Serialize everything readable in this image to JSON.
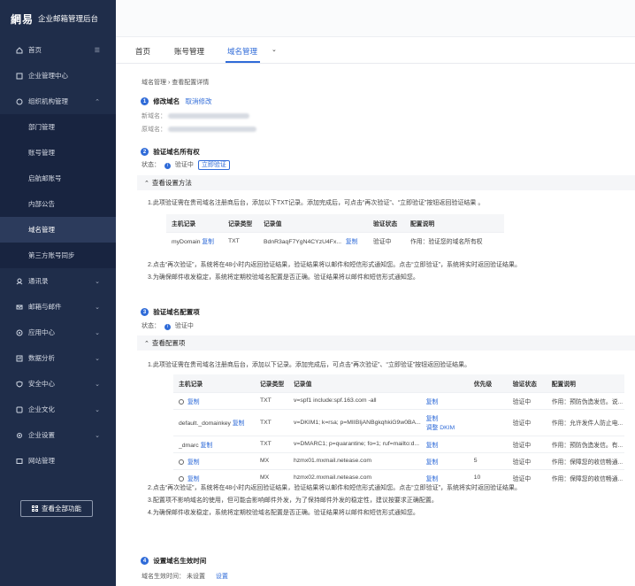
{
  "app": {
    "logo_mark": "網易",
    "title": "企业邮箱管理后台"
  },
  "sidebar": {
    "items": [
      {
        "label": "首页",
        "icon": "home-icon",
        "chevron": ""
      },
      {
        "label": "企业管理中心",
        "icon": "building-icon",
        "chevron": ""
      },
      {
        "label": "组织机构管理",
        "icon": "org-icon",
        "chevron": "up"
      },
      {
        "label": "部门管理",
        "sub": true
      },
      {
        "label": "账号管理",
        "sub": true
      },
      {
        "label": "启航邮账号",
        "sub": true
      },
      {
        "label": "内部公告",
        "sub": true
      },
      {
        "label": "域名管理",
        "sub": true,
        "active": true
      },
      {
        "label": "第三方账号同步",
        "sub": true
      },
      {
        "label": "通讯录",
        "icon": "contacts-icon",
        "chevron": "down"
      },
      {
        "label": "邮箱与邮件",
        "icon": "mail-icon",
        "chevron": "down"
      },
      {
        "label": "应用中心",
        "icon": "app-icon",
        "chevron": "down"
      },
      {
        "label": "数据分析",
        "icon": "chart-icon",
        "chevron": "down"
      },
      {
        "label": "安全中心",
        "icon": "shield-icon",
        "chevron": "down"
      },
      {
        "label": "企业文化",
        "icon": "culture-icon",
        "chevron": "down"
      },
      {
        "label": "企业设置",
        "icon": "gear-icon",
        "chevron": "down"
      },
      {
        "label": "网站管理",
        "icon": "web-icon",
        "chevron": ""
      }
    ],
    "all_functions_label": "查看全部功能"
  },
  "tabs": {
    "home": "首页",
    "account": "账号管理",
    "domain": "域名管理"
  },
  "breadcrumb": {
    "parent": "域名管理",
    "sep": "›",
    "current": "查看配置详情"
  },
  "step1": {
    "num": "1",
    "title": "修改域名",
    "cancel": "取消修改",
    "new_domain_label": "新域名：",
    "old_domain_label": "原域名："
  },
  "step2": {
    "num": "2",
    "title": "验证域名所有权",
    "status_label": "状态：",
    "status_value": "验证中",
    "verify_now": "立即验证",
    "panel_title": "查看设置方法",
    "instr1": "1.此项验证需在贵司域名注册商后台，添加以下TXT记录。添加完成后，可点击“再次验证”、“立即验证”按钮返回验证结果 。",
    "table": {
      "headers": [
        "主机记录",
        "记录类型",
        "记录值",
        "",
        "验证状态",
        "配置说明"
      ],
      "row": {
        "host": "myDomain",
        "copy": "复制",
        "type": "TXT",
        "value": "BdnR3aqF7YgN4CYzU4Fx...",
        "copy2": "复制",
        "status": "验证中",
        "desc": "作用：验证您的域名所有权"
      }
    },
    "instr2": "2.点击“再次验证”，系统将在48小时内返回验证结果，验证结果将以邮件和短信形式通知您。点击“立即验证”，系统将实时返回验证结果。",
    "instr3": "3.为确保邮件收发稳定，系统将定期校验域名配置是否正确。验证结果将以邮件和短信形式通知您。"
  },
  "step3": {
    "num": "3",
    "title": "验证域名配置项",
    "status_label": "状态：",
    "status_value": "验证中",
    "panel_title": "查看配置项",
    "instr1": "1.此项验证需在贵司域名注册商后台，添加以下记录。添加完成后，可点击“再次验证”、“立即验证”按钮返回验证结果。",
    "table": {
      "headers": [
        "主机记录",
        "记录类型",
        "记录值",
        "",
        "优先级",
        "验证状态",
        "配置说明"
      ],
      "rows": [
        {
          "host": "@",
          "copy": "复制",
          "type": "TXT",
          "value": "v=spf1 include:spf.163.com -all",
          "copy2": "复制",
          "extra": "",
          "priority": "",
          "status": "验证中",
          "desc": "作用：预防伪造发信。说..."
        },
        {
          "host": "default._domainkey",
          "copy": "复制",
          "type": "TXT",
          "value": "v=DKIM1; k=rsa; p=MIIBIjANBgkqhkiG9w0BA...",
          "copy2": "复制",
          "extra": "调整 DKIM",
          "priority": "",
          "status": "验证中",
          "desc": "作用：允许发件人防止电..."
        },
        {
          "host": "_dmarc",
          "copy": "复制",
          "type": "TXT",
          "value": "v=DMARC1; p=quarantine; fo=1; ruf=mailto:d...",
          "copy2": "复制",
          "extra": "",
          "priority": "",
          "status": "验证中",
          "desc": "作用：预防伪造发信。有..."
        },
        {
          "host": "@",
          "copy": "复制",
          "type": "MX",
          "value": "hzmx01.mxmail.netease.com",
          "copy2": "复制",
          "extra": "",
          "priority": "5",
          "status": "验证中",
          "desc": "作用：保障您的收信畅通..."
        },
        {
          "host": "@",
          "copy": "复制",
          "type": "MX",
          "value": "hzmx02.mxmail.netease.com",
          "copy2": "复制",
          "extra": "",
          "priority": "10",
          "status": "验证中",
          "desc": "作用：保障您的收信畅通..."
        }
      ]
    },
    "instr2": "2.点击“再次验证”，系统将在48小时内返回验证结果，验证结果将以邮件和短信形式通知您。点击“立即验证”，系统将实时返回验证结果。",
    "instr3": "3.配置项不影响域名的使用，但可能会影响邮件外发，为了保持邮件外发的稳定性，建议按要求正确配置。",
    "instr4": "4.为确保邮件收发稳定，系统将定期校验域名配置是否正确。验证结果将以邮件和短信形式通知您。"
  },
  "step4": {
    "num": "4",
    "title": "设置域名生效时间",
    "effective_label": "域名生效时间：",
    "effective_value": "未设置",
    "set": "设置"
  },
  "colors": {
    "sidebar_bg": "#1f2d4a",
    "accent": "#2f6bd8"
  }
}
